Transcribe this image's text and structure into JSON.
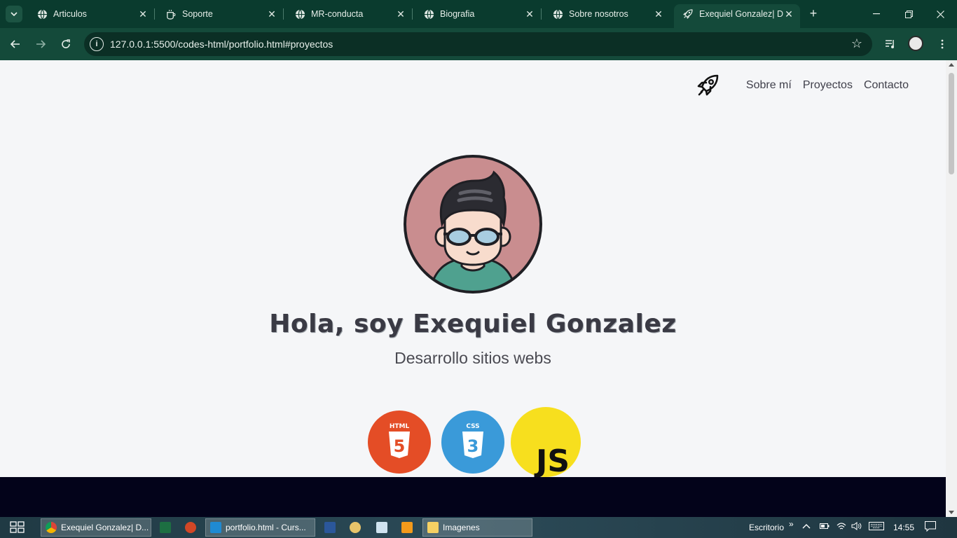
{
  "browser": {
    "tabs": [
      {
        "title": "Articulos",
        "icon": "globe-icon",
        "active": false
      },
      {
        "title": "Soporte",
        "icon": "cup-icon",
        "active": false
      },
      {
        "title": "MR-conducta",
        "icon": "globe-icon",
        "active": false
      },
      {
        "title": "Biografia",
        "icon": "globe-icon",
        "active": false
      },
      {
        "title": "Sobre nosotros",
        "icon": "globe-icon",
        "active": false
      },
      {
        "title": "Exequiel Gonzalez| Desarrollador",
        "icon": "rocket-icon",
        "active": true
      }
    ],
    "new_tab_symbol": "+",
    "url": "127.0.0.1:5500/codes-html/portfolio.html#proyectos",
    "colors": {
      "frame": "#0a3b2e",
      "toolbar": "#144a3a",
      "omnibox": "#0b2f25"
    }
  },
  "page": {
    "nav": {
      "logo_icon": "rocket-icon",
      "links": [
        "Sobre mí",
        "Proyectos",
        "Contacto"
      ]
    },
    "hero": {
      "avatar_icon": "developer-avatar-icon",
      "title": "Hola, soy Exequiel Gonzalez",
      "subtitle": "Desarrollo sitios webs"
    },
    "tech": [
      {
        "name": "HTML5",
        "label": "HTML",
        "badge": "5",
        "color": "#e44d26"
      },
      {
        "name": "CSS3",
        "label": "CSS",
        "badge": "3",
        "color": "#3a9ad9"
      },
      {
        "name": "JavaScript",
        "label": "JS",
        "color": "#f7df1e"
      }
    ],
    "colors": {
      "background": "#f5f6f8",
      "footer_band": "#03031a"
    }
  },
  "taskbar": {
    "items": [
      {
        "label": "Exequiel Gonzalez| D...",
        "icon": "chrome-icon"
      },
      {
        "label": "",
        "icon": "excel-icon"
      },
      {
        "label": "",
        "icon": "powerpoint-icon"
      },
      {
        "label": "portfolio.html - Curs...",
        "icon": "vscode-icon"
      },
      {
        "label": "",
        "icon": "word-icon"
      },
      {
        "label": "",
        "icon": "paint-icon"
      },
      {
        "label": "",
        "icon": "notepad-icon"
      },
      {
        "label": "",
        "icon": "media-player-icon"
      },
      {
        "label": "Imagenes",
        "icon": "folder-icon"
      }
    ],
    "tray": {
      "desktop_label": "Escritorio",
      "chevron": "»",
      "time": "14:55"
    }
  }
}
